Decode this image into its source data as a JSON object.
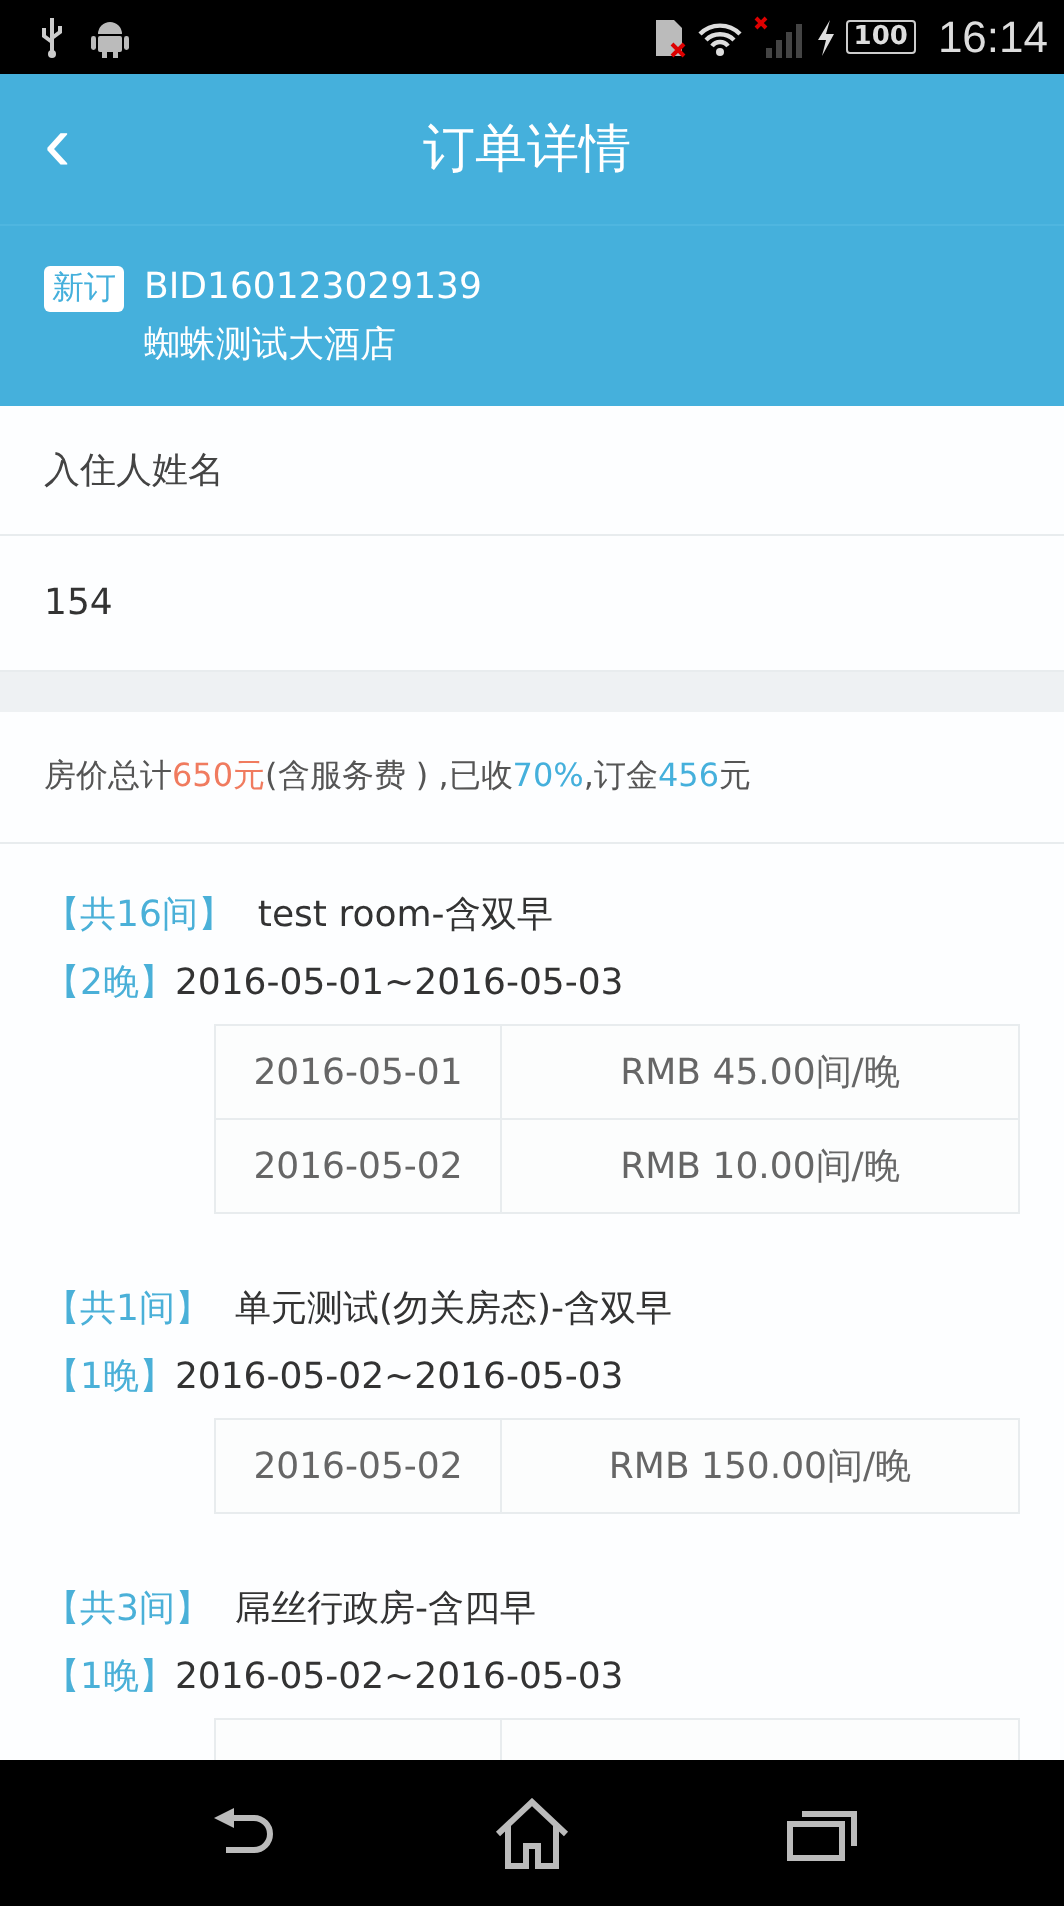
{
  "status_bar": {
    "time": "16:14",
    "battery": "100"
  },
  "title_bar": {
    "back": "‹",
    "title": "订单详情"
  },
  "order": {
    "badge": "新订",
    "number": "BID160123029139",
    "hotel": "蜘蛛测试大酒店"
  },
  "guest": {
    "label": "入住人姓名",
    "value": "154"
  },
  "summary": [
    {
      "kind": "plain",
      "text": "房价总计"
    },
    {
      "kind": "price",
      "text": "650元"
    },
    {
      "kind": "plain",
      "text": "(含服务费 ) ,已收"
    },
    {
      "kind": "rate",
      "text": "70%"
    },
    {
      "kind": "plain",
      "text": ",订金"
    },
    {
      "kind": "rate",
      "text": "456"
    },
    {
      "kind": "plain",
      "text": "元"
    }
  ],
  "rooms": [
    {
      "count": "【共16间】",
      "name": "test room-含双早",
      "nights": "【2晚】",
      "dates": "2016-05-01~2016-05-03",
      "rows": [
        {
          "date": "2016-05-01",
          "price": "RMB 45.00间/晚"
        },
        {
          "date": "2016-05-02",
          "price": "RMB 10.00间/晚"
        }
      ]
    },
    {
      "count": "【共1间】",
      "name": "单元测试(勿关房态)-含双早",
      "nights": "【1晚】",
      "dates": "2016-05-02~2016-05-03",
      "rows": [
        {
          "date": "2016-05-02",
          "price": "RMB 150.00间/晚"
        }
      ]
    },
    {
      "count": "【共3间】",
      "name": "屌丝行政房-含四早",
      "nights": "【1晚】",
      "dates": "2016-05-02~2016-05-03"
    }
  ]
}
